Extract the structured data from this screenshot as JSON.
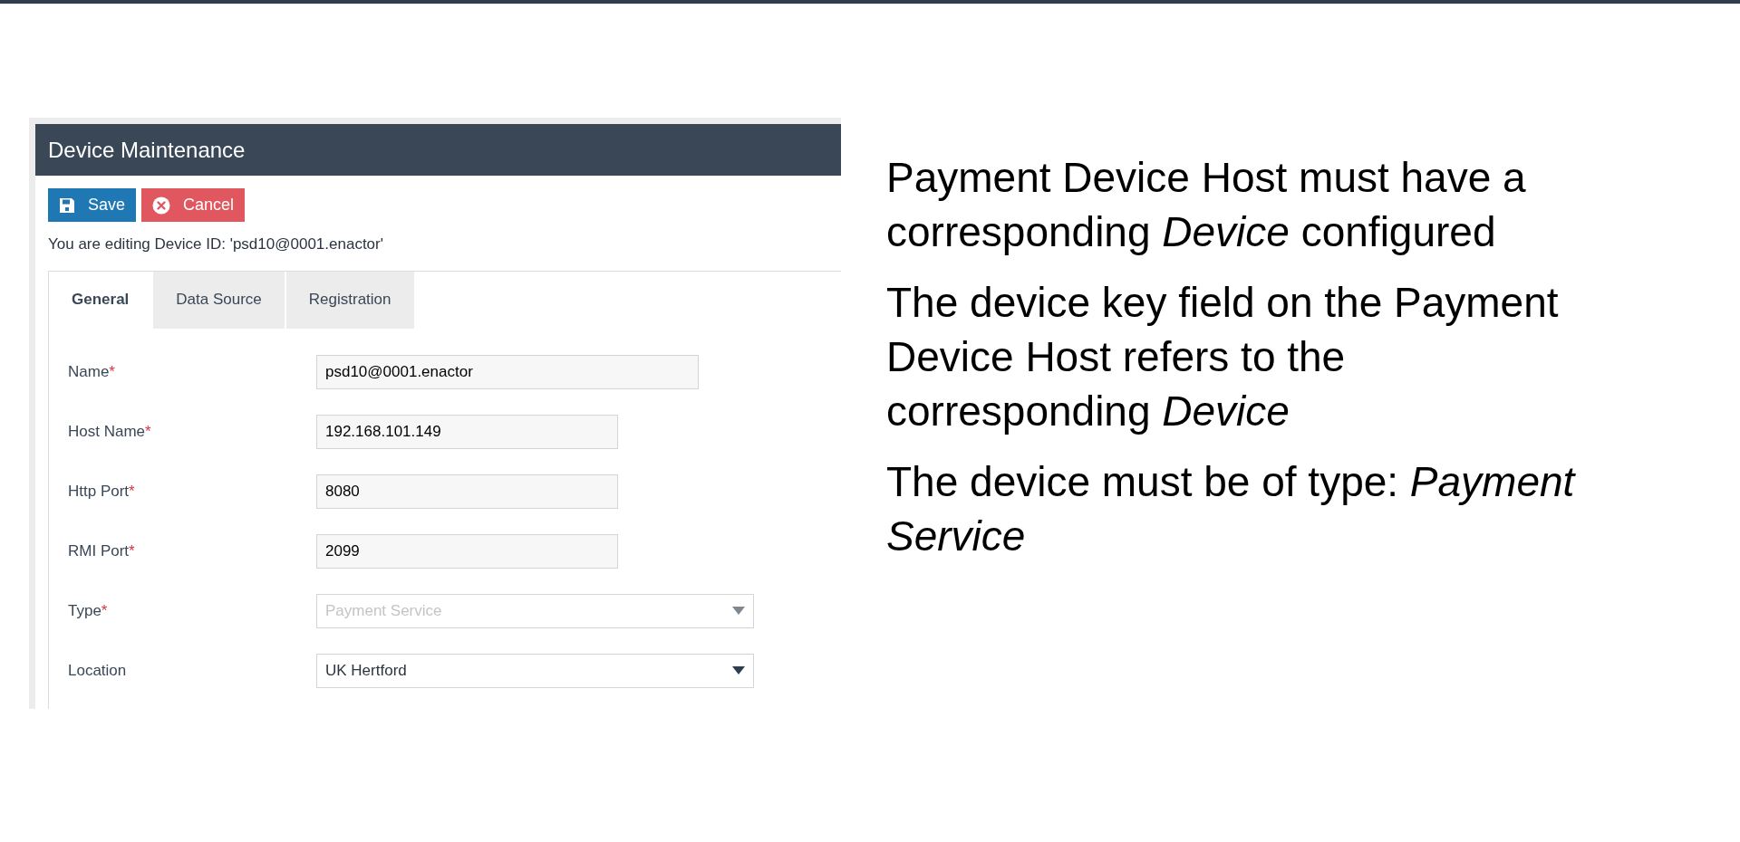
{
  "app": {
    "title": "Device Maintenance",
    "buttons": [
      {
        "label": "Save",
        "kind": "save"
      },
      {
        "label": "Cancel",
        "kind": "cancel"
      }
    ],
    "editing_note": "You are editing Device ID: 'psd10@0001.enactor'",
    "tabs": [
      {
        "label": "General",
        "selected": true
      },
      {
        "label": "Data Source",
        "selected": false
      },
      {
        "label": "Registration",
        "selected": false
      }
    ],
    "fields": [
      {
        "label": "Name",
        "required_mark": "*",
        "kind": "text",
        "value": "psd10@0001.enactor",
        "disabled": false,
        "wide": true
      },
      {
        "label": "Host Name",
        "required_mark": "*",
        "kind": "text",
        "value": "192.168.101.149",
        "disabled": false,
        "wide": false
      },
      {
        "label": "Http Port",
        "required_mark": "*",
        "kind": "text",
        "value": "8080",
        "disabled": false,
        "wide": false
      },
      {
        "label": "RMI Port",
        "required_mark": "*",
        "kind": "text",
        "value": "2099",
        "disabled": false,
        "wide": false
      },
      {
        "label": "Type",
        "required_mark": "*",
        "kind": "select",
        "value": "Payment Service",
        "disabled": true,
        "wide": true
      },
      {
        "label": "Location",
        "kind": "select",
        "value": "UK Hertford",
        "disabled": false,
        "wide": true
      }
    ]
  },
  "notes": [
    "Payment Device Host must have a corresponding *Device* configured",
    "The device key field on the Payment Device Host refers to the corresponding *Device*",
    "The device must be of type: *Payment Service*"
  ]
}
